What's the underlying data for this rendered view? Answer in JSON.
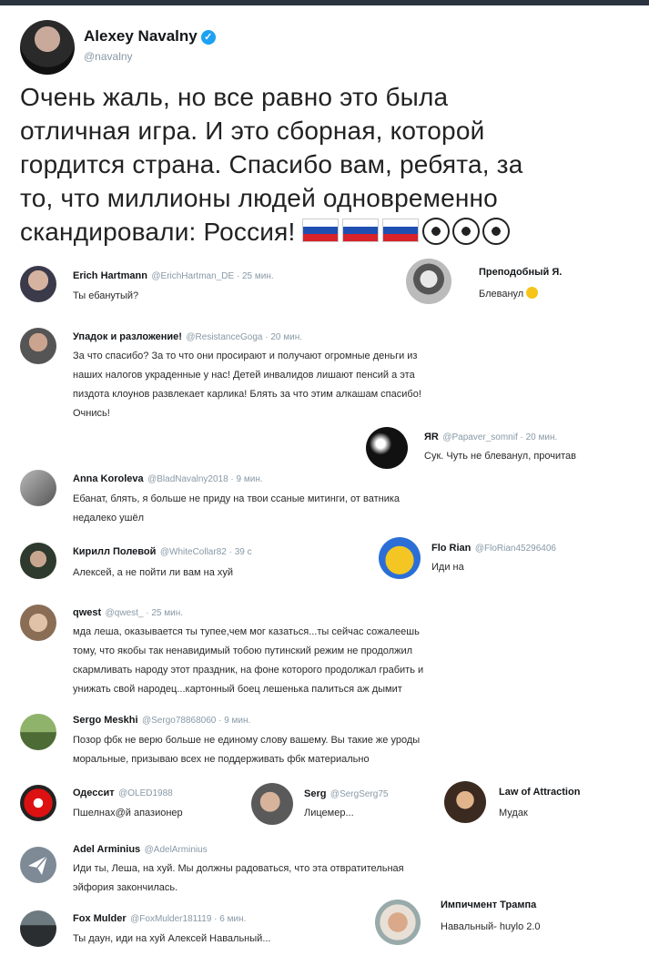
{
  "main_tweet": {
    "name": "Alexey Navalny",
    "handle": "@navalny",
    "lines": [
      "Очень жаль, но все равно это была",
      "отличная игра. И это сборная, которой",
      "гордится страна. Спасибо вам, ребята, за",
      "то, что миллионы людей одновременно",
      "скандировали: Россия!"
    ]
  },
  "replies": [
    {
      "id": "r1",
      "name": "Erich Hartmann",
      "meta": "@ErichHartman_DE · 25 мин.",
      "lines": [
        "Ты ебанутый?"
      ]
    },
    {
      "id": "r2",
      "name": "Преподобный Я.",
      "meta": "",
      "lines": [
        "Блеванул"
      ]
    },
    {
      "id": "r3",
      "name": "Упадок и разложение!",
      "meta": "@ResistanceGoga · 20 мин.",
      "lines": [
        "За что спасибо? За то что они просирают и получают огромные деньги из",
        "наших налогов украденные у нас! Детей инвалидов лишают пенсий а эта",
        "пиздота клоунов развлекает карлика! Блять за что этим алкашам спасибо!",
        "Очнись!"
      ]
    },
    {
      "id": "r4",
      "name": "ЯR",
      "meta": "@Papaver_somnif · 20 мин.",
      "lines": [
        "Сук. Чуть не блеванул, прочитав"
      ]
    },
    {
      "id": "r5",
      "name": "Anna Koroleva",
      "meta": "@BladNavalny2018 · 9 мин.",
      "lines": [
        "Ебанат, блять, я больше не приду на твои ссаные митинги, от ватника",
        "недалеко ушёл"
      ]
    },
    {
      "id": "r6",
      "name": "Кирилл Полевой",
      "meta": "@WhiteCollar82 · 39 с",
      "lines": [
        "Алексей, а не пойти ли вам на хуй"
      ]
    },
    {
      "id": "r7",
      "name": "Flo Rian",
      "meta": "@FloRian45296406",
      "lines": [
        "Иди на"
      ]
    },
    {
      "id": "r8",
      "name": "qwest",
      "meta": "@qwest_ · 25 мин.",
      "lines": [
        "мда леша, оказывается ты тупее,чем мог казаться...ты сейчас сожалеешь",
        "тому, что якобы так ненавидимый тобою путинский режим не продолжил",
        "скармливать народу этот праздник, на фоне которого продолжал грабить и",
        "унижать свой народец...картонный боец лешенька палиться аж дымит"
      ]
    },
    {
      "id": "r9",
      "name": "Sergo Meskhi",
      "meta": "@Sergo78868060 · 9 мин.",
      "lines": [
        "Позор фбк не верю больше не единому слову вашему. Вы такие же уроды",
        "моральные, призываю всех не поддерживать фбк материально"
      ]
    },
    {
      "id": "r10",
      "name": "Одессит",
      "meta": "@OLED1988",
      "lines": [
        "Пшелнах@й  апазионер"
      ]
    },
    {
      "id": "r11",
      "name": "Serg",
      "meta": "@SergSerg75",
      "lines": [
        "Лицемер..."
      ]
    },
    {
      "id": "r12",
      "name": "Law of Attraction",
      "meta": "",
      "lines": [
        "Мудак"
      ]
    },
    {
      "id": "r13",
      "name": "Adel Arminius",
      "meta": "@AdelArminius",
      "lines": [
        "Иди ты, Леша, на хуй. Мы должны радоваться, что эта отвратительная",
        "эйфория закончилась."
      ]
    },
    {
      "id": "r14",
      "name": "Импичмент Трампа",
      "meta": "",
      "lines": [
        "Навальный- huylo 2.0"
      ]
    },
    {
      "id": "r15",
      "name": "Fox Mulder",
      "meta": "@FoxMulder181119 · 6 мин.",
      "lines": [
        "Ты даун, иди на хуй Алексей Навальный..."
      ]
    }
  ],
  "icons": {
    "verified": "verified-badge-icon",
    "flag": "russia-flag-emoji",
    "ball": "soccer-ball-emoji",
    "grin": "grimacing-face-emoji"
  },
  "colors": {
    "verified": "#1da1f2",
    "muted": "#8899a6",
    "flag_blue": "#1f4fb0",
    "flag_red": "#d8232a"
  }
}
